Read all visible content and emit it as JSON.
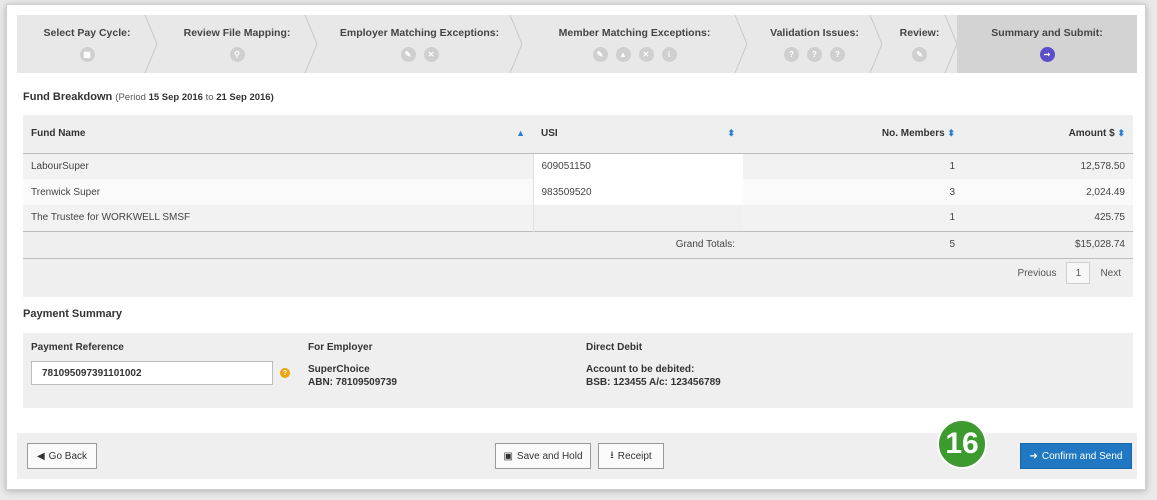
{
  "wizard": {
    "steps": [
      {
        "label": "Select Pay Cycle:",
        "icons": [
          "calendar-icon"
        ]
      },
      {
        "label": "Review File Mapping:",
        "icons": [
          "search-icon"
        ]
      },
      {
        "label": "Employer Matching Exceptions:",
        "icons": [
          "pencil-icon",
          "close-icon"
        ]
      },
      {
        "label": "Member Matching Exceptions:",
        "icons": [
          "pencil-icon",
          "warning-icon",
          "close-icon",
          "info-icon"
        ]
      },
      {
        "label": "Validation Issues:",
        "icons": [
          "question-icon",
          "question-icon",
          "question-icon"
        ]
      },
      {
        "label": "Review:",
        "icons": [
          "pencil-icon"
        ]
      },
      {
        "label": "Summary and Submit:",
        "icons": [
          "arrow-right-icon"
        ]
      }
    ]
  },
  "fund_breakdown": {
    "title": "Fund Breakdown",
    "period_prefix": "(Period",
    "period_from": "15 Sep 2016",
    "period_to_word": "to",
    "period_to": "21 Sep 2016)",
    "columns": [
      "Fund Name",
      "USI",
      "No. Members",
      "Amount $"
    ],
    "rows": [
      {
        "fund": "LabourSuper",
        "usi": "609051150",
        "members": "1",
        "amount": "12,578.50"
      },
      {
        "fund": "Trenwick Super",
        "usi": "983509520",
        "members": "3",
        "amount": "2,024.49"
      },
      {
        "fund": "The Trustee for WORKWELL SMSF",
        "usi": "",
        "members": "1",
        "amount": "425.75"
      }
    ],
    "totals_label": "Grand Totals:",
    "total_members": "5",
    "total_amount": "$15,028.74",
    "pager": {
      "previous": "Previous",
      "page": "1",
      "next": "Next"
    }
  },
  "payment_summary": {
    "title": "Payment Summary",
    "ref_label": "Payment Reference",
    "ref_value": "781095097391101002",
    "employer_label": "For Employer",
    "employer_name": "SuperChoice",
    "employer_abn": "ABN: 78109509739",
    "debit_label": "Direct Debit",
    "debit_account_label": "Account to be debited:",
    "debit_account": "BSB: 123455 A/c: 123456789"
  },
  "footer": {
    "go_back": "Go Back",
    "save_hold": "Save and Hold",
    "receipt": "Receipt",
    "confirm": "Confirm and Send"
  },
  "annotation_badge": "16",
  "colors": {
    "accent": "#1f78c1",
    "active_step": "#5b4fc9",
    "badge": "#3d9a2e",
    "help": "#f0a30a"
  }
}
